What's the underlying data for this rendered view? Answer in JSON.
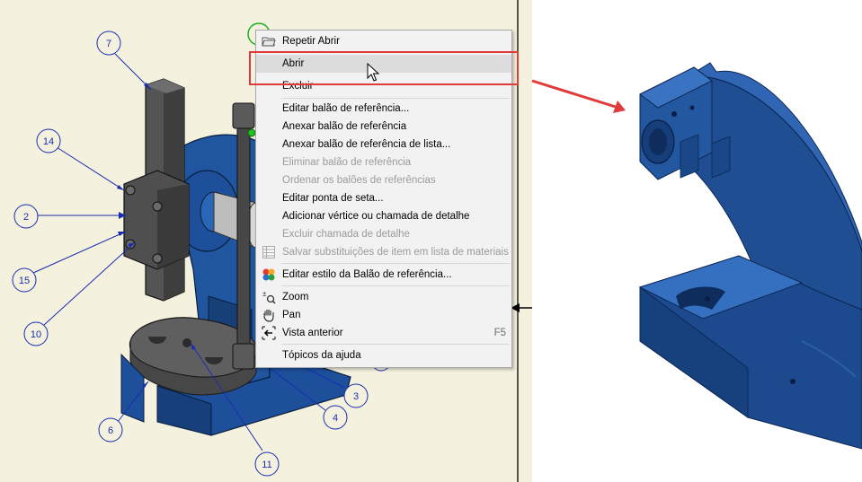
{
  "context_menu": {
    "items": [
      {
        "label": "Repetir Abrir",
        "shortcut": "",
        "enabled": true,
        "icon": "open-folder-icon"
      },
      {
        "label": "Abrir",
        "shortcut": "",
        "enabled": true,
        "icon": ""
      },
      {
        "label": "Excluir",
        "shortcut": "",
        "enabled": true,
        "icon": ""
      },
      {
        "label": "Editar balão de referência...",
        "shortcut": "",
        "enabled": true,
        "icon": ""
      },
      {
        "label": "Anexar balão de referência",
        "shortcut": "",
        "enabled": true,
        "icon": ""
      },
      {
        "label": "Anexar balão de referência de lista...",
        "shortcut": "",
        "enabled": true,
        "icon": ""
      },
      {
        "label": "Eliminar balão de referência",
        "shortcut": "",
        "enabled": false,
        "icon": ""
      },
      {
        "label": "Ordenar os balões de referências",
        "shortcut": "",
        "enabled": false,
        "icon": ""
      },
      {
        "label": "Editar ponta de seta...",
        "shortcut": "",
        "enabled": true,
        "icon": ""
      },
      {
        "label": "Adicionar vértice ou chamada de detalhe",
        "shortcut": "",
        "enabled": true,
        "icon": ""
      },
      {
        "label": "Excluir chamada de detalhe",
        "shortcut": "",
        "enabled": false,
        "icon": ""
      },
      {
        "label": "Salvar substituições de item em lista de materiais",
        "shortcut": "",
        "enabled": false,
        "icon": "table-icon"
      },
      {
        "label": "Editar estilo da Balão de referência...",
        "shortcut": "",
        "enabled": true,
        "icon": "style-icon"
      },
      {
        "label": "Zoom",
        "shortcut": "",
        "enabled": true,
        "icon": "zoom-icon"
      },
      {
        "label": "Pan",
        "shortcut": "",
        "enabled": true,
        "icon": "pan-hand-icon"
      },
      {
        "label": "Vista anterior",
        "shortcut": "F5",
        "enabled": true,
        "icon": "previous-view-icon"
      },
      {
        "label": "Tópicos da ajuda",
        "shortcut": "",
        "enabled": true,
        "icon": ""
      }
    ],
    "hovered_item": "Abrir"
  },
  "balloons": [
    "7",
    "14",
    "2",
    "15",
    "10",
    "6",
    "11",
    "4",
    "3"
  ],
  "colors": {
    "drawing_background": "#f4f1de",
    "part_blue": "#1d4f9a",
    "balloon_blue": "#1a2db0",
    "highlight_red": "#e03a3a",
    "menu_background": "#f2f2f2"
  }
}
